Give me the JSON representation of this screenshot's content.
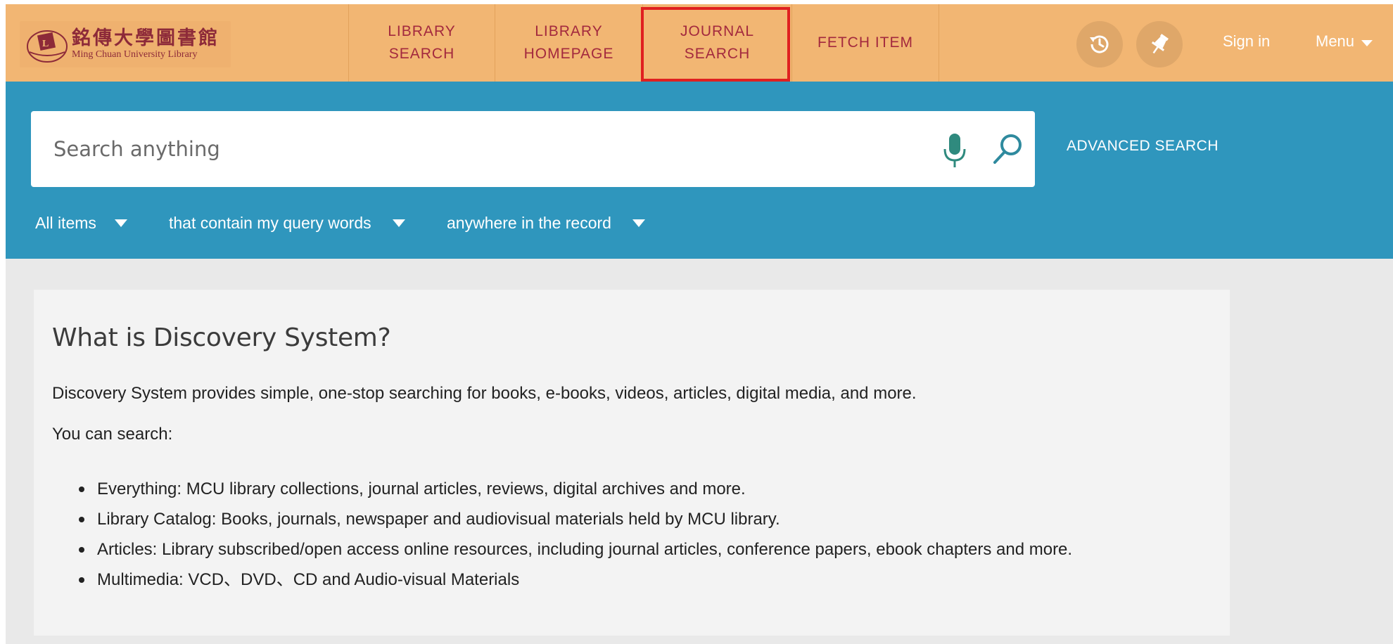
{
  "header": {
    "logo": {
      "name_cn": "銘傳大學圖書館",
      "name_en": "Ming Chuan University Library"
    },
    "nav": [
      {
        "label": "LIBRARY\nSEARCH"
      },
      {
        "label": "LIBRARY\nHOMEPAGE"
      },
      {
        "label": "JOURNAL\nSEARCH"
      },
      {
        "label": "FETCH ITEM"
      }
    ],
    "icons": {
      "history": "history-icon",
      "pin": "pin-icon"
    },
    "signin_label": "Sign in",
    "menu_label": "Menu"
  },
  "search": {
    "placeholder": "Search anything",
    "advanced_label": "ADVANCED SEARCH",
    "filters": [
      {
        "value": "All items"
      },
      {
        "value": "that contain my query words"
      },
      {
        "value": "anywhere in the record"
      }
    ]
  },
  "content": {
    "title": "What is Discovery System?",
    "description": "Discovery System provides simple, one-stop searching for books, e-books, videos, articles, digital media, and more.",
    "you_can_search": "You can search:",
    "items": [
      "Everything: MCU library collections, journal articles, reviews, digital archives and more.",
      "Library Catalog: Books, journals, newspaper and audiovisual materials held by MCU library.",
      "Articles: Library subscribed/open access online resources, including journal articles, conference papers, ebook chapters and more.",
      "Multimedia: VCD、DVD、CD and Audio-visual Materials"
    ]
  },
  "colors": {
    "header_bg": "#f2b673",
    "nav_text": "#a3293e",
    "search_band": "#2f96bd",
    "highlight": "#e02020",
    "page_bg": "#e9e9e9",
    "card_bg": "#f3f3f3"
  }
}
